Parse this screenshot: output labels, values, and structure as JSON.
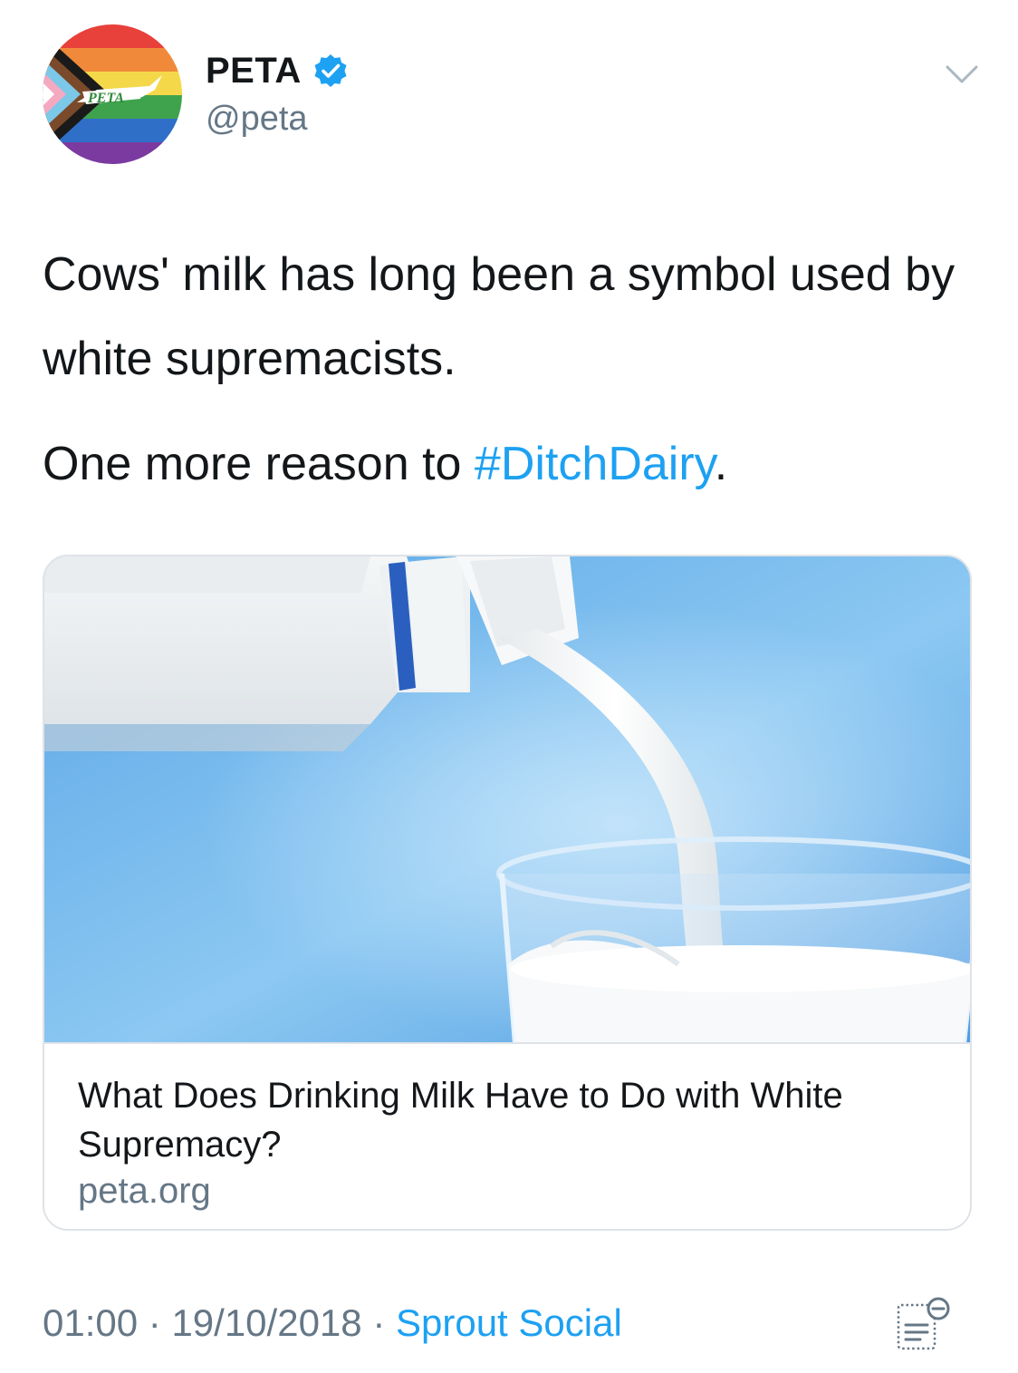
{
  "author": {
    "display_name": "PETA",
    "handle": "@peta",
    "verified": true,
    "avatar_logo_text": "PETA",
    "avatar_icon": "peta-pride-flag-avatar"
  },
  "tweet": {
    "line1": "Cows' milk has long been a symbol used by white supremacists.",
    "line2_prefix": "One more reason to ",
    "hashtag": "#DitchDairy",
    "line2_suffix": "."
  },
  "card": {
    "image_icon": "milk-pouring-photo",
    "title": "What Does Drinking Milk Have to Do with White Supremacy?",
    "domain": "peta.org"
  },
  "meta": {
    "time": "01:00",
    "separator": " · ",
    "date": "19/10/2018",
    "source": "Sprout Social"
  },
  "colors": {
    "accent": "#1da1f2",
    "secondary_text": "#657786",
    "primary_text": "#14171a",
    "border": "#dfe3e8"
  },
  "icons": {
    "verified": "verified-badge-icon",
    "menu": "chevron-down-icon",
    "analytics": "tweet-analytics-icon"
  }
}
